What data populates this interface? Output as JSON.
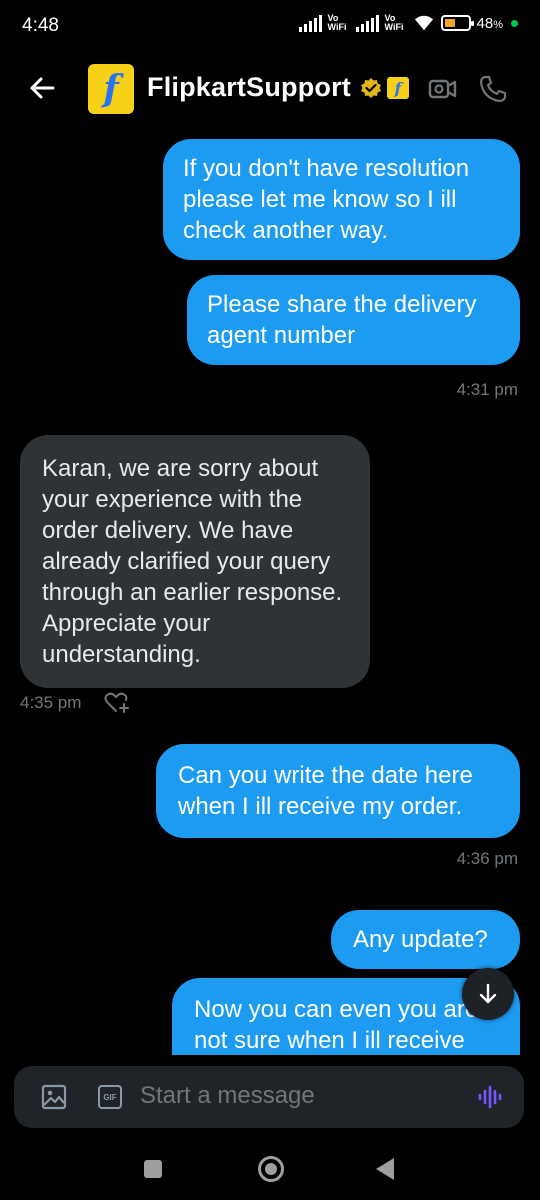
{
  "status_bar": {
    "time": "4:48",
    "sim1_label": "Vo WiFi",
    "sim2_label": "Vo WiFi",
    "battery_percent": "48",
    "battery_suffix": "%",
    "battery_level": 0.48
  },
  "header": {
    "title": "FlipkartSupport",
    "avatar_letter": "f",
    "affiliate_letter": "f",
    "icons": [
      "back-arrow-icon",
      "verified-badge-icon",
      "video-call-icon",
      "phone-call-icon"
    ]
  },
  "messages": [
    {
      "direction": "sent",
      "text": "If you don't have resolution please let me know so I ill check another way."
    },
    {
      "direction": "sent",
      "text": "Please share the delivery agent number",
      "time": "4:31 pm"
    },
    {
      "direction": "received",
      "text": "Karan, we are sorry about your experience with the order delivery. We have already clarified your query through an earlier response. Appreciate your understanding.",
      "time": "4:35 pm"
    },
    {
      "direction": "sent",
      "text": "Can you write the date here when I ill receive my order.",
      "time": "4:36 pm"
    },
    {
      "direction": "sent",
      "text": "Any update?"
    },
    {
      "direction": "sent",
      "text": "Now you can even you are not sure when I ill receive"
    }
  ],
  "composer": {
    "placeholder": "Start a message",
    "gif_label": "GIF"
  },
  "colors": {
    "sent_bubble": "#1d9bf0",
    "received_bubble": "#2f3336",
    "background": "#000000",
    "brand_yellow": "#f7d117",
    "brand_blue": "#2874f0",
    "voice_accent": "#7856ff"
  }
}
